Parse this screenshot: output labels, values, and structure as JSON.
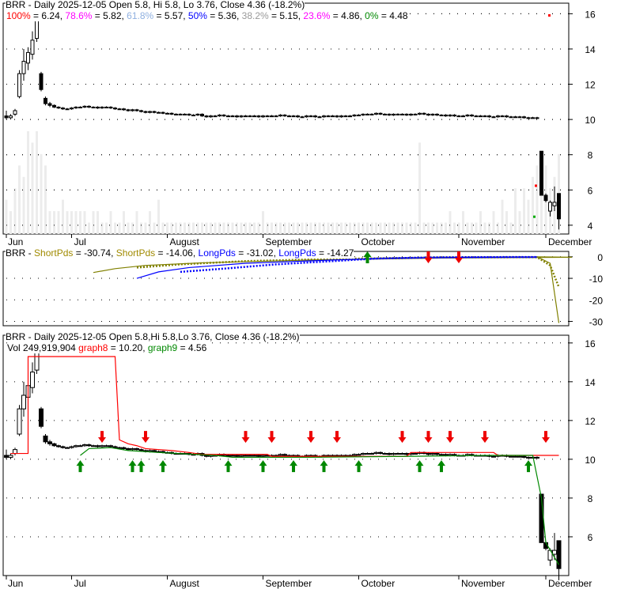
{
  "chart_data": [
    {
      "type": "candlestick",
      "title": "BRR - Daily 2025-12-05 Open 5.8, Hi 5.8, Lo 3.76, Close 4.36 (-18.2%)",
      "fib": [
        {
          "label": "100%",
          "value": "6.24",
          "color": "#ff0000"
        },
        {
          "label": "78.6%",
          "value": "5.82",
          "color": "#ff00ff"
        },
        {
          "label": "61.8%",
          "value": "5.57",
          "color": "#8fb0e0"
        },
        {
          "label": "50%",
          "value": "5.36",
          "color": "#0000ff"
        },
        {
          "label": "38.2%",
          "value": "5.15",
          "color": "#999999"
        },
        {
          "label": "23.6%",
          "value": "4.86",
          "color": "#ff00ff"
        },
        {
          "label": "0%",
          "value": "4.48",
          "color": "#008800"
        }
      ],
      "yticks": [
        4,
        6,
        8,
        10,
        12,
        14,
        16
      ],
      "ylim": [
        3.5,
        16.6
      ],
      "xticks": [
        {
          "label": "Jun",
          "i": 0
        },
        {
          "label": "Jul",
          "i": 15
        },
        {
          "label": "August",
          "i": 37
        },
        {
          "label": "September",
          "i": 59
        },
        {
          "label": "October",
          "i": 81
        },
        {
          "label": "November",
          "i": 104
        },
        {
          "label": "December",
          "i": 124
        }
      ]
    },
    {
      "type": "line",
      "title": "BRR",
      "series": [
        {
          "name": "ShortPds",
          "value": "-30.74",
          "color": "#808000",
          "style": "solid",
          "points": [
            [
              20,
              -7.3
            ],
            [
              25,
              -5.5
            ],
            [
              32,
              -4
            ],
            [
              45,
              -2.8
            ],
            [
              70,
              -1.5
            ],
            [
              100,
              -0.6
            ],
            [
              130,
              -0.2
            ],
            [
              122,
              0
            ],
            [
              125,
              -3
            ],
            [
              127,
              -30.74
            ]
          ]
        },
        {
          "name": "ShortPds",
          "value": "-14.06",
          "color": "#808000",
          "style": "dotted",
          "points": [
            [
              30,
              -5
            ],
            [
              40,
              -3.5
            ],
            [
              55,
              -2
            ],
            [
              75,
              -1
            ],
            [
              100,
              -0.3
            ],
            [
              122,
              -0.2
            ],
            [
              125,
              -4
            ],
            [
              127,
              -14.06
            ]
          ]
        },
        {
          "name": "LongPds",
          "value": "-31.02",
          "color": "#0000ff",
          "style": "solid",
          "points": [
            [
              30,
              -10
            ],
            [
              35,
              -7
            ],
            [
              42,
              -5
            ],
            [
              55,
              -3
            ],
            [
              75,
              -1.5
            ],
            [
              90,
              -0.6
            ],
            [
              110,
              -0.2
            ],
            [
              122,
              -0.1
            ]
          ]
        },
        {
          "name": "LongPds",
          "value": "-14.27",
          "color": "#0000ff",
          "style": "dotted",
          "points": [
            [
              40,
              -7
            ],
            [
              50,
              -5.5
            ],
            [
              62,
              -3.5
            ],
            [
              75,
              -2
            ],
            [
              85,
              -0.8
            ],
            [
              100,
              -0.2
            ],
            [
              122,
              -0.1
            ]
          ]
        }
      ],
      "arrows_up": [
        83
      ],
      "arrows_down": [
        97,
        104
      ],
      "yticks": [
        0,
        -10,
        -20,
        -30
      ],
      "ylim": [
        -32,
        2.5
      ]
    },
    {
      "type": "candlestick",
      "title": "BRR - Daily 2025-12-05 Open 5.8,Hi 5.8,Lo 3.76, Close 4.36 (-18.2%)",
      "vol_label": "Vol 249,919,904",
      "series": [
        {
          "name": "graph8",
          "value": "10.20",
          "color": "#ff0000",
          "points": [
            [
              1,
              10.3
            ],
            [
              5,
              10.3
            ],
            [
              5,
              15.3
            ],
            [
              25,
              15.3
            ],
            [
              26,
              11
            ],
            [
              28,
              10.8
            ],
            [
              30,
              10.7
            ],
            [
              32,
              10.55
            ],
            [
              38,
              10.45
            ],
            [
              42,
              10.35
            ],
            [
              45,
              10.25
            ],
            [
              60,
              10.25
            ],
            [
              61,
              10.15
            ],
            [
              92,
              10.15
            ],
            [
              93,
              10.35
            ],
            [
              112,
              10.35
            ],
            [
              113,
              10.2
            ],
            [
              127,
              10.2
            ]
          ]
        },
        {
          "name": "graph9",
          "value": "4.56",
          "color": "#008800",
          "points": [
            [
              17,
              10.2
            ],
            [
              19,
              10.55
            ],
            [
              24,
              10.6
            ],
            [
              28,
              10.45
            ],
            [
              35,
              10.35
            ],
            [
              48,
              10.2
            ],
            [
              52,
              10.1
            ],
            [
              70,
              10.1
            ],
            [
              92,
              10.15
            ],
            [
              110,
              10.2
            ],
            [
              121,
              10.2
            ],
            [
              123,
              8
            ],
            [
              124,
              5.7
            ],
            [
              127,
              4.56
            ]
          ]
        }
      ],
      "arrows_down": [
        22,
        32,
        55,
        61,
        70,
        76,
        91,
        97,
        102,
        110,
        124
      ],
      "arrows_up": [
        17,
        29,
        31,
        36,
        51,
        59,
        66,
        73,
        81,
        95,
        100,
        120
      ],
      "yticks": [
        6,
        8,
        10,
        12,
        14,
        16
      ],
      "ylim": [
        4,
        16.4
      ]
    }
  ],
  "candles_head": [
    [
      10.2,
      10.5,
      10.0,
      10.1
    ],
    [
      10.1,
      10.3,
      10.0,
      10.2
    ],
    [
      10.3,
      10.6,
      10.2,
      10.5
    ],
    [
      11.3,
      12.8,
      11.2,
      12.6
    ],
    [
      12.6,
      14.0,
      12.2,
      13.3
    ],
    [
      13.2,
      14.1,
      12.8,
      13.8
    ],
    [
      13.7,
      15.0,
      13.4,
      14.5
    ],
    [
      14.6,
      16.3,
      14.4,
      15.7
    ],
    [
      12.6,
      12.7,
      11.6,
      11.7
    ],
    [
      11.2,
      11.3,
      10.8,
      10.9
    ],
    [
      10.9,
      11.0,
      10.7,
      10.8
    ]
  ],
  "closes_mid": [
    10.7,
    10.65,
    10.6,
    10.6,
    10.65,
    10.7,
    10.7,
    10.75,
    10.7,
    10.7,
    10.65,
    10.7,
    10.7,
    10.65,
    10.6,
    10.6,
    10.55,
    10.5,
    10.55,
    10.5,
    10.45,
    10.4,
    10.45,
    10.4,
    10.4,
    10.35,
    10.35,
    10.3,
    10.3,
    10.3,
    10.3,
    10.25,
    10.25,
    10.3,
    10.2,
    10.15,
    10.2,
    10.2,
    10.25,
    10.2,
    10.2,
    10.2,
    10.15,
    10.2,
    10.2,
    10.2,
    10.2,
    10.15,
    10.2,
    10.2,
    10.2,
    10.2,
    10.25,
    10.2,
    10.2,
    10.2,
    10.15,
    10.15,
    10.2,
    10.2,
    10.15,
    10.15,
    10.2,
    10.2,
    10.2,
    10.15,
    10.2,
    10.2,
    10.2,
    10.25,
    10.25,
    10.3,
    10.3,
    10.3,
    10.35,
    10.3,
    10.3,
    10.25,
    10.3,
    10.3,
    10.3,
    10.25,
    10.3,
    10.3,
    10.35,
    10.3,
    10.25,
    10.3,
    10.25,
    10.25,
    10.2,
    10.25,
    10.2,
    10.2,
    10.2,
    10.25,
    10.2,
    10.2,
    10.2,
    10.2,
    10.15,
    10.15,
    10.2,
    10.2,
    10.15,
    10.15,
    10.15,
    10.15,
    10.1,
    10.1,
    10.1,
    10.1
  ],
  "candles_tail": [
    [
      8.2,
      8.2,
      5.7,
      5.7
    ],
    [
      5.7,
      5.8,
      5.3,
      5.4
    ],
    [
      4.8,
      5.4,
      4.5,
      5.3
    ],
    [
      5.1,
      6.2,
      4.8,
      5.3
    ],
    [
      5.8,
      5.8,
      3.76,
      4.36
    ]
  ],
  "volume_rel": [
    3,
    2,
    4,
    6,
    5,
    9,
    8,
    9,
    7,
    6,
    2,
    2,
    2,
    3,
    2,
    2,
    2,
    2,
    2,
    1,
    2,
    2,
    1,
    1,
    2,
    1,
    1,
    2,
    1,
    1,
    2,
    1,
    1,
    2,
    1,
    3,
    1,
    1,
    1,
    1,
    1,
    1,
    1,
    1,
    1,
    1,
    1,
    1,
    1,
    1,
    1,
    1,
    1,
    1,
    1,
    1,
    1,
    1,
    1,
    2,
    1,
    1,
    1,
    1,
    1,
    1,
    1,
    1,
    1,
    1,
    1,
    1,
    1,
    1,
    1,
    1,
    1,
    1,
    1,
    1,
    1,
    1,
    1,
    1,
    1,
    1,
    1,
    1,
    1,
    1,
    1,
    1,
    1,
    1,
    1,
    8,
    1,
    1,
    1,
    1,
    1,
    1,
    2,
    1,
    1,
    2,
    1,
    1,
    1,
    2,
    1,
    1,
    2,
    1,
    3,
    2,
    1,
    4,
    2,
    4,
    3,
    5,
    6,
    7,
    6,
    4,
    5,
    7
  ]
}
